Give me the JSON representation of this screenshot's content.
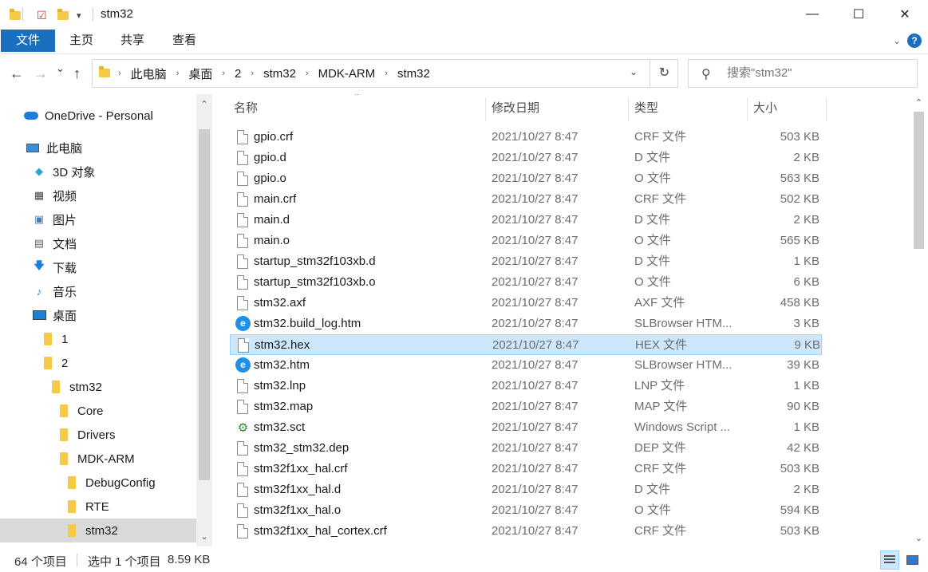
{
  "window": {
    "title": "stm32",
    "minimize": "—",
    "maximize": "☐",
    "close": "✕"
  },
  "ribbon": {
    "tabs": [
      "文件",
      "主页",
      "共享",
      "查看"
    ]
  },
  "nav": {
    "back": "←",
    "forward": "→",
    "recent": "⌄",
    "up": "↑",
    "breadcrumb": [
      "此电脑",
      "桌面",
      "2",
      "stm32",
      "MDK-ARM",
      "stm32"
    ],
    "refresh": "↻",
    "search_placeholder": "搜索\"stm32\""
  },
  "sidebar": {
    "items": [
      {
        "label": "OneDrive - Personal",
        "icon": "cloud-icon"
      },
      {
        "label": "此电脑",
        "icon": "computer-icon"
      },
      {
        "label": "3D 对象",
        "icon": "3d-objects-icon"
      },
      {
        "label": "视频",
        "icon": "video-icon"
      },
      {
        "label": "图片",
        "icon": "pictures-icon"
      },
      {
        "label": "文档",
        "icon": "documents-icon"
      },
      {
        "label": "下载",
        "icon": "download-icon"
      },
      {
        "label": "音乐",
        "icon": "music-icon"
      },
      {
        "label": "桌面",
        "icon": "desktop-icon"
      },
      {
        "label": "1",
        "icon": "folder-icon"
      },
      {
        "label": "2",
        "icon": "folder-icon"
      },
      {
        "label": "stm32",
        "icon": "folder-icon"
      },
      {
        "label": "Core",
        "icon": "folder-icon"
      },
      {
        "label": "Drivers",
        "icon": "folder-icon"
      },
      {
        "label": "MDK-ARM",
        "icon": "folder-icon"
      },
      {
        "label": "DebugConfig",
        "icon": "folder-icon"
      },
      {
        "label": "RTE",
        "icon": "folder-icon"
      },
      {
        "label": "stm32",
        "icon": "folder-icon"
      }
    ],
    "selected_index": 17
  },
  "list": {
    "columns": {
      "name": "名称",
      "date": "修改日期",
      "type": "类型",
      "size": "大小"
    },
    "rows": [
      {
        "name": "gpio.crf",
        "date": "2021/10/27 8:47",
        "type": "CRF 文件",
        "size": "503 KB",
        "icon": "file"
      },
      {
        "name": "gpio.d",
        "date": "2021/10/27 8:47",
        "type": "D 文件",
        "size": "2 KB",
        "icon": "file"
      },
      {
        "name": "gpio.o",
        "date": "2021/10/27 8:47",
        "type": "O 文件",
        "size": "563 KB",
        "icon": "file"
      },
      {
        "name": "main.crf",
        "date": "2021/10/27 8:47",
        "type": "CRF 文件",
        "size": "502 KB",
        "icon": "file"
      },
      {
        "name": "main.d",
        "date": "2021/10/27 8:47",
        "type": "D 文件",
        "size": "2 KB",
        "icon": "file"
      },
      {
        "name": "main.o",
        "date": "2021/10/27 8:47",
        "type": "O 文件",
        "size": "565 KB",
        "icon": "file"
      },
      {
        "name": "startup_stm32f103xb.d",
        "date": "2021/10/27 8:47",
        "type": "D 文件",
        "size": "1 KB",
        "icon": "file"
      },
      {
        "name": "startup_stm32f103xb.o",
        "date": "2021/10/27 8:47",
        "type": "O 文件",
        "size": "6 KB",
        "icon": "file"
      },
      {
        "name": "stm32.axf",
        "date": "2021/10/27 8:47",
        "type": "AXF 文件",
        "size": "458 KB",
        "icon": "file"
      },
      {
        "name": "stm32.build_log.htm",
        "date": "2021/10/27 8:47",
        "type": "SLBrowser HTM...",
        "size": "3 KB",
        "icon": "web"
      },
      {
        "name": "stm32.hex",
        "date": "2021/10/27 8:47",
        "type": "HEX 文件",
        "size": "9 KB",
        "icon": "file"
      },
      {
        "name": "stm32.htm",
        "date": "2021/10/27 8:47",
        "type": "SLBrowser HTM...",
        "size": "39 KB",
        "icon": "web"
      },
      {
        "name": "stm32.lnp",
        "date": "2021/10/27 8:47",
        "type": "LNP 文件",
        "size": "1 KB",
        "icon": "file"
      },
      {
        "name": "stm32.map",
        "date": "2021/10/27 8:47",
        "type": "MAP 文件",
        "size": "90 KB",
        "icon": "file"
      },
      {
        "name": "stm32.sct",
        "date": "2021/10/27 8:47",
        "type": "Windows Script ...",
        "size": "1 KB",
        "icon": "script"
      },
      {
        "name": "stm32_stm32.dep",
        "date": "2021/10/27 8:47",
        "type": "DEP 文件",
        "size": "42 KB",
        "icon": "file"
      },
      {
        "name": "stm32f1xx_hal.crf",
        "date": "2021/10/27 8:47",
        "type": "CRF 文件",
        "size": "503 KB",
        "icon": "file"
      },
      {
        "name": "stm32f1xx_hal.d",
        "date": "2021/10/27 8:47",
        "type": "D 文件",
        "size": "2 KB",
        "icon": "file"
      },
      {
        "name": "stm32f1xx_hal.o",
        "date": "2021/10/27 8:47",
        "type": "O 文件",
        "size": "594 KB",
        "icon": "file"
      },
      {
        "name": "stm32f1xx_hal_cortex.crf",
        "date": "2021/10/27 8:47",
        "type": "CRF 文件",
        "size": "503 KB",
        "icon": "file"
      }
    ],
    "selected_index": 10
  },
  "status": {
    "count": "64 个项目",
    "selected": "选中 1 个项目",
    "selected_size": "8.59 KB"
  },
  "colors": {
    "accent": "#1a6fbf",
    "selection_bg": "#cce8ff",
    "selection_border": "#99d1ff",
    "folder": "#f7c948"
  }
}
